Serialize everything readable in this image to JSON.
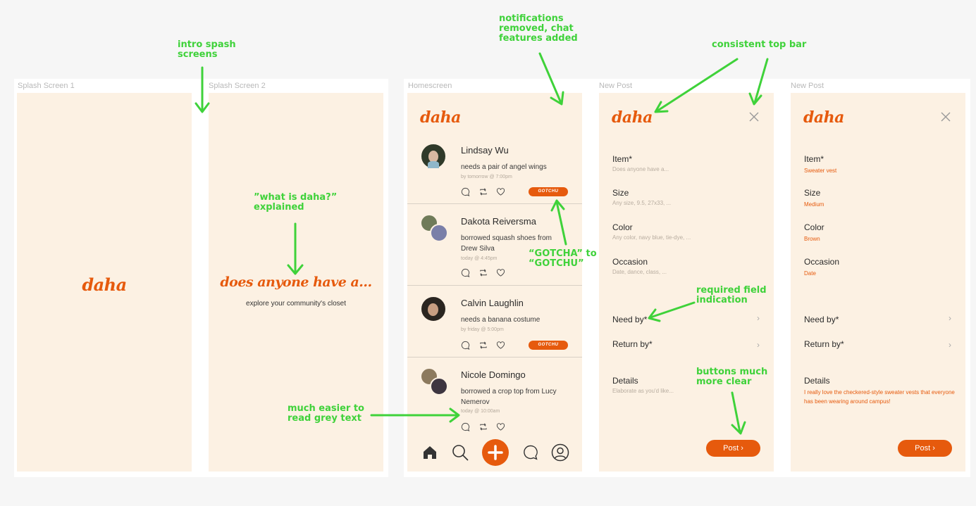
{
  "frames": [
    {
      "title": "Splash Screen 1"
    },
    {
      "title": "Splash Screen 2"
    },
    {
      "title": "Homescreen"
    },
    {
      "title": "New Post"
    },
    {
      "title": "New Post"
    }
  ],
  "brand": {
    "logo": "daha",
    "accent": "#e65a0d",
    "bg": "#fcf1e3"
  },
  "splash2": {
    "headline": "does anyone have a...",
    "subtitle": "explore your community's closet"
  },
  "feed": [
    {
      "name": "Lindsay Wu",
      "desc": "needs a pair of angel wings",
      "time": "by tomorrow @ 7:00pm",
      "action": "GOTCHU"
    },
    {
      "name": "Dakota Reiversma",
      "desc": "borrowed squash shoes from Drew Silva",
      "time": "today @ 4:45pm"
    },
    {
      "name": "Calvin Laughlin",
      "desc": "needs a banana costume",
      "time": "by friday @ 5:00pm",
      "action": "GOTCHU"
    },
    {
      "name": "Nicole Domingo",
      "desc": "borrowed a crop top from Lucy Nemerov",
      "time": "today @ 10:00am"
    }
  ],
  "nav": {
    "icons": [
      "home-icon",
      "search-icon",
      "add-icon",
      "chat-icon",
      "profile-icon"
    ]
  },
  "newpost_empty": {
    "item": {
      "label": "Item*",
      "hint": "Does anyone have a..."
    },
    "size": {
      "label": "Size",
      "hint": "Any size, 9.5, 27x33, ..."
    },
    "color": {
      "label": "Color",
      "hint": "Any color, navy blue, tie-dye, ..."
    },
    "occasion": {
      "label": "Occasion",
      "hint": "Date, dance, class, ..."
    },
    "needby": {
      "label": "Need by*"
    },
    "returnby": {
      "label": "Return by*"
    },
    "details": {
      "label": "Details",
      "hint": "Elaborate as you'd like..."
    },
    "post": "Post  ›"
  },
  "newpost_filled": {
    "item": {
      "label": "Item*",
      "value": "Sweater vest"
    },
    "size": {
      "label": "Size",
      "value": "Medium"
    },
    "color": {
      "label": "Color",
      "value": "Brown"
    },
    "occasion": {
      "label": "Occasion",
      "value": "Date"
    },
    "needby": {
      "label": "Need by*"
    },
    "returnby": {
      "label": "Return by*"
    },
    "details": {
      "label": "Details",
      "value": "I really love the checkered-style sweater vests that everyone has been wearing around campus!"
    },
    "post": "Post  ›"
  },
  "annotations": {
    "intro": "intro spash\nscreens",
    "what": "”what is daha?”\nexplained",
    "notif": "notifications\nremoved, chat\nfeatures added",
    "gotcha": "“GOTCHA” to\n“GOTCHU”",
    "grey": "much easier to\nread grey text",
    "topbar": "consistent top bar",
    "required": "required field\nindication",
    "buttons": "buttons much\nmore clear"
  },
  "annotation_color": "#3fd23a"
}
